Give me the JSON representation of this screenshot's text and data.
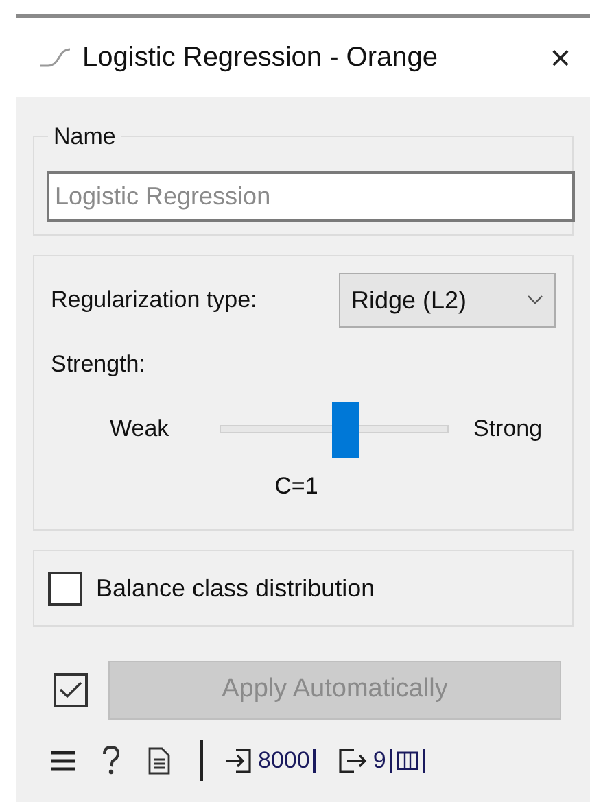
{
  "window": {
    "title": "Logistic Regression - Orange",
    "close": "×"
  },
  "name_box": {
    "title": "Name",
    "placeholder": "Logistic Regression"
  },
  "regularization": {
    "label": "Regularization type:",
    "value": "Ridge (L2)",
    "strength_label": "Strength:",
    "min_label": "Weak",
    "max_label": "Strong",
    "level": 0.55,
    "reading": "C=1"
  },
  "balance": {
    "label": "Balance class distribution",
    "checked": false
  },
  "apply": {
    "checked": true,
    "label": "Apply Automatically",
    "disabled": true
  },
  "status_bar": {
    "input_count": "8000",
    "output_count": "9"
  }
}
